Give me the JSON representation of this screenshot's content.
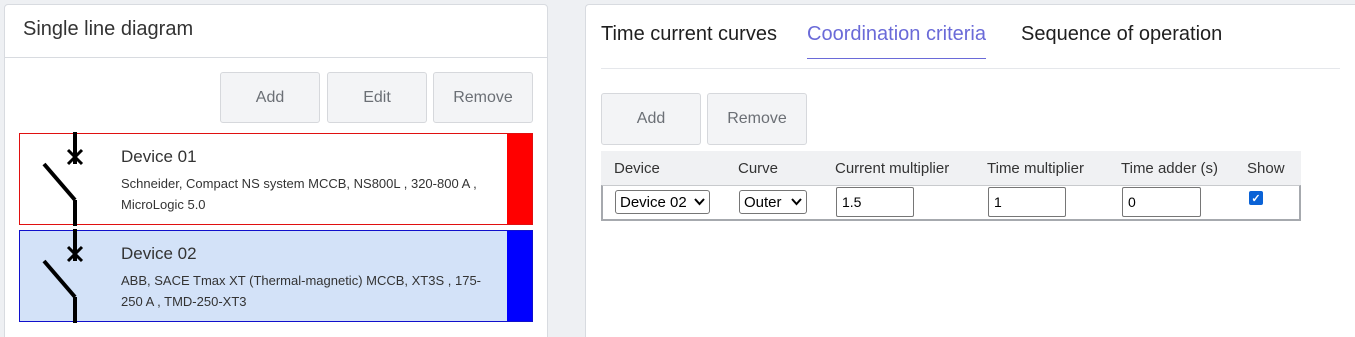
{
  "left_panel": {
    "title": "Single line diagram",
    "buttons": {
      "add": "Add",
      "edit": "Edit",
      "remove": "Remove"
    },
    "devices": [
      {
        "name": "Device 01",
        "description": "Schneider, Compact NS system MCCB, NS800L , 320-800 A , MicroLogic 5.0",
        "color": "#ff0000"
      },
      {
        "name": "Device 02",
        "description": "ABB, SACE Tmax XT (Thermal-magnetic) MCCB, XT3S , 175-250 A , TMD-250-XT3",
        "color": "#0000ff"
      }
    ]
  },
  "right_panel": {
    "tabs": [
      "Time current curves",
      "Coordination criteria",
      "Sequence of operation"
    ],
    "active_tab": "Coordination criteria",
    "buttons": {
      "add": "Add",
      "remove": "Remove"
    },
    "table": {
      "headers": [
        "Device",
        "Curve",
        "Current multiplier",
        "Time multiplier",
        "Time adder (s)",
        "Show"
      ],
      "rows": [
        {
          "device": "Device 02",
          "curve": "Outer",
          "current_multiplier": "1.5",
          "time_multiplier": "1",
          "time_adder": "0",
          "show": true
        }
      ]
    }
  },
  "icons": {
    "breaker_symbol": "circuit-breaker-icon",
    "dropdown": "chevron-down-icon",
    "checkbox": "checkbox-checked-icon"
  }
}
